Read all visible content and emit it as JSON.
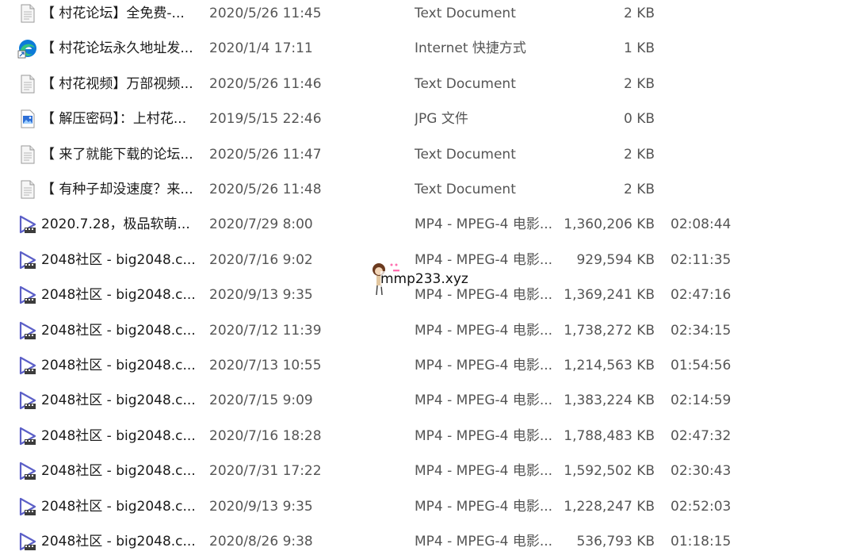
{
  "files": [
    {
      "icon": "text-document-icon",
      "name": "【 村花论坛】全免费-...",
      "date": "2020/5/26 11:45",
      "type": "Text Document",
      "size": "2 KB",
      "length": ""
    },
    {
      "icon": "edge-shortcut-icon",
      "name": "【 村花论坛永久地址发...",
      "date": "2020/1/4 17:11",
      "type": "Internet 快捷方式",
      "size": "1 KB",
      "length": ""
    },
    {
      "icon": "text-document-icon",
      "name": "【 村花视频】万部视频...",
      "date": "2020/5/26 11:46",
      "type": "Text Document",
      "size": "2 KB",
      "length": ""
    },
    {
      "icon": "jpg-image-icon",
      "name": "【 解压密码】：上村花...",
      "date": "2019/5/15 22:46",
      "type": "JPG 文件",
      "size": "0 KB",
      "length": ""
    },
    {
      "icon": "text-document-icon",
      "name": "【 来了就能下载的论坛...",
      "date": "2020/5/26 11:47",
      "type": "Text Document",
      "size": "2 KB",
      "length": ""
    },
    {
      "icon": "text-document-icon",
      "name": "【 有种子却没速度？来...",
      "date": "2020/5/26 11:48",
      "type": "Text Document",
      "size": "2 KB",
      "length": ""
    },
    {
      "icon": "video-file-icon",
      "name": "2020.7.28，极品软萌...",
      "date": "2020/7/29 8:00",
      "type": "MP4 - MPEG-4 电影...",
      "size": "1,360,206 KB",
      "length": "02:08:44"
    },
    {
      "icon": "video-file-icon",
      "name": "2048社区 - big2048.c...",
      "date": "2020/7/16 9:02",
      "type": "MP4 - MPEG-4 电影...",
      "size": "929,594 KB",
      "length": "02:11:35"
    },
    {
      "icon": "video-file-icon",
      "name": "2048社区 - big2048.c...",
      "date": "2020/9/13 9:35",
      "type": "MP4 - MPEG-4 电影...",
      "size": "1,369,241 KB",
      "length": "02:47:16"
    },
    {
      "icon": "video-file-icon",
      "name": "2048社区 - big2048.c...",
      "date": "2020/7/12 11:39",
      "type": "MP4 - MPEG-4 电影...",
      "size": "1,738,272 KB",
      "length": "02:34:15"
    },
    {
      "icon": "video-file-icon",
      "name": "2048社区 - big2048.c...",
      "date": "2020/7/13 10:55",
      "type": "MP4 - MPEG-4 电影...",
      "size": "1,214,563 KB",
      "length": "01:54:56"
    },
    {
      "icon": "video-file-icon",
      "name": "2048社区 - big2048.c...",
      "date": "2020/7/15 9:09",
      "type": "MP4 - MPEG-4 电影...",
      "size": "1,383,224 KB",
      "length": "02:14:59"
    },
    {
      "icon": "video-file-icon",
      "name": "2048社区 - big2048.c...",
      "date": "2020/7/16 18:28",
      "type": "MP4 - MPEG-4 电影...",
      "size": "1,788,483 KB",
      "length": "02:47:32"
    },
    {
      "icon": "video-file-icon",
      "name": "2048社区 - big2048.c...",
      "date": "2020/7/31 17:22",
      "type": "MP4 - MPEG-4 电影...",
      "size": "1,592,502 KB",
      "length": "02:30:43"
    },
    {
      "icon": "video-file-icon",
      "name": "2048社区 - big2048.c...",
      "date": "2020/9/13 9:35",
      "type": "MP4 - MPEG-4 电影...",
      "size": "1,228,247 KB",
      "length": "02:52:03"
    },
    {
      "icon": "video-file-icon",
      "name": "2048社区 - big2048.c...",
      "date": "2020/8/26 9:38",
      "type": "MP4 - MPEG-4 电影...",
      "size": "536,793 KB",
      "length": "01:18:15"
    }
  ],
  "watermark": {
    "text": "mmp233.xyz",
    "icon": "cartoon-girl-watermark-icon"
  },
  "colors": {
    "text_primary": "#1a1a1a",
    "text_secondary": "#555555",
    "video_icon": "#5b5fc7",
    "edge_blue": "#0c7bd8",
    "edge_green": "#33c481"
  }
}
